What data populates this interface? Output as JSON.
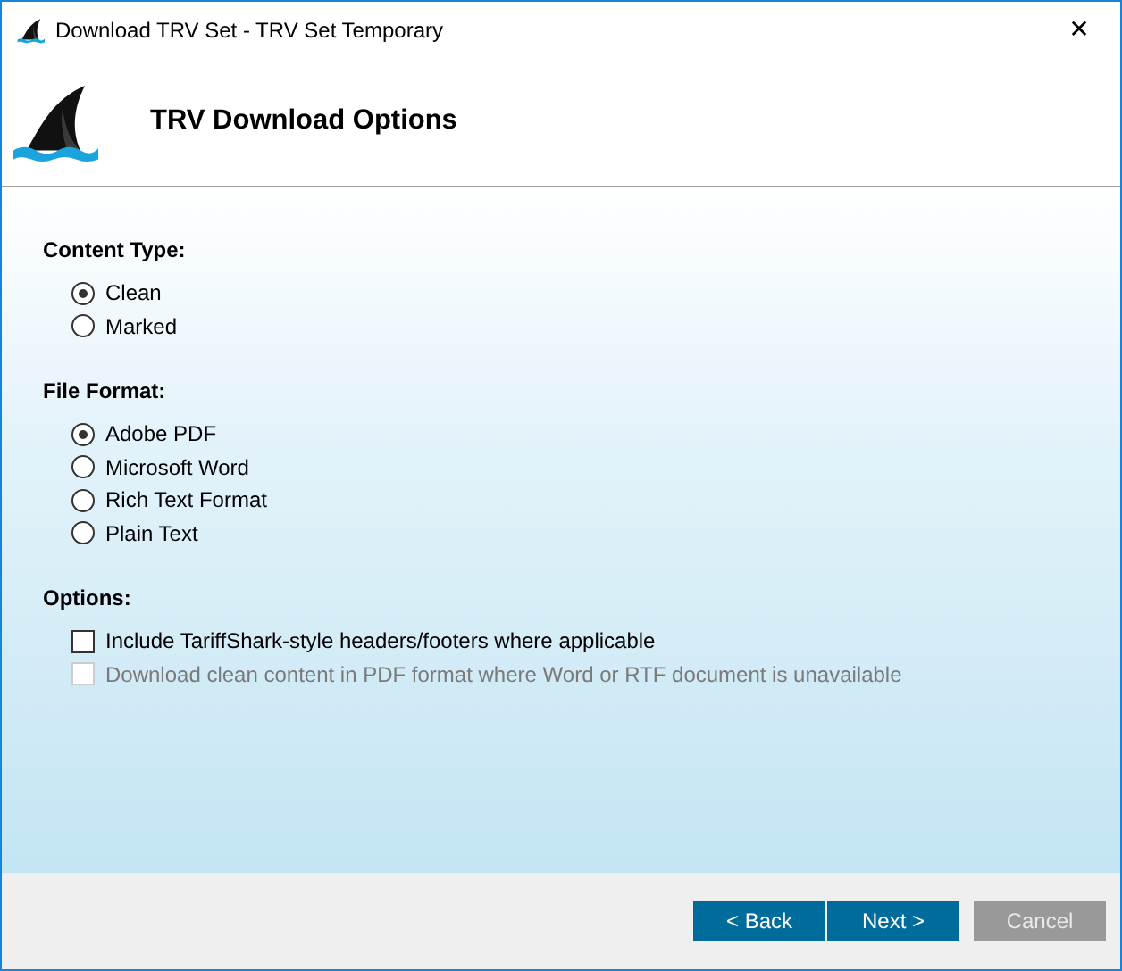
{
  "window": {
    "title": "Download TRV Set - TRV Set Temporary",
    "close": "✕"
  },
  "header": {
    "title": "TRV Download Options"
  },
  "groups": [
    {
      "kind": "radio",
      "label": "Content Type:",
      "items": [
        {
          "label": "Clean",
          "selected": true
        },
        {
          "label": "Marked",
          "selected": false
        }
      ]
    },
    {
      "kind": "radio",
      "label": "File Format:",
      "items": [
        {
          "label": "Adobe PDF",
          "selected": true
        },
        {
          "label": "Microsoft Word",
          "selected": false
        },
        {
          "label": "Rich Text Format",
          "selected": false
        },
        {
          "label": "Plain Text",
          "selected": false
        }
      ]
    },
    {
      "kind": "checkbox",
      "label": "Options:",
      "items": [
        {
          "label": "Include TariffShark-style headers/footers where applicable",
          "checked": false,
          "disabled": false
        },
        {
          "label": "Download clean content in PDF format where Word or RTF document is unavailable",
          "checked": false,
          "disabled": true
        }
      ]
    }
  ],
  "buttons": [
    {
      "label": "< Back",
      "disabled": false
    },
    {
      "label": "Next >",
      "disabled": false
    },
    {
      "label": "Cancel",
      "disabled": true
    }
  ]
}
